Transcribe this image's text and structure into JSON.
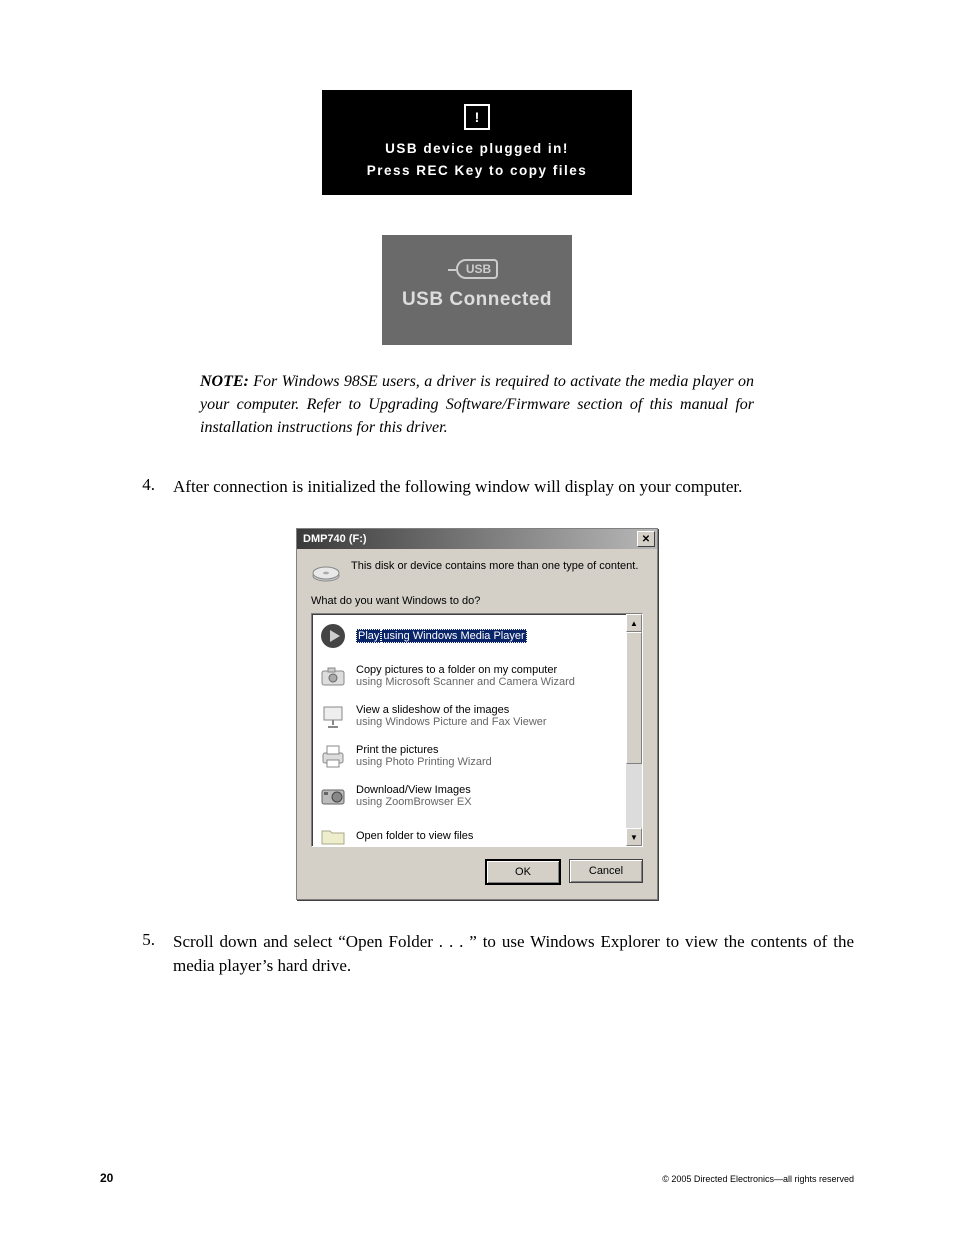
{
  "banner1": {
    "line1": "USB device plugged in!",
    "line2": "Press REC Key to copy files"
  },
  "banner2": {
    "logo": "USB",
    "text": "USB Connected"
  },
  "note": {
    "label": "NOTE:",
    "body": "For Windows 98SE users, a driver is required to activate the media player on your computer. Refer to Upgrading Software/Firmware section of this manual for installation instructions for this driver."
  },
  "steps": {
    "s4": {
      "num": "4.",
      "text": "After connection is initialized the following window will display on your computer."
    },
    "s5": {
      "num": "5.",
      "text": "Scroll down and select “Open Folder . . . ” to use Windows Explorer to view the contents of the media player’s hard drive."
    }
  },
  "dialog": {
    "title": "DMP740 (F:)",
    "close": "✕",
    "msg": "This disk or device contains more than one type of content.",
    "question": "What do you want Windows to do?",
    "options": [
      {
        "t1": "Play",
        "t2": "using Windows Media Player",
        "selected": true,
        "icon": "play"
      },
      {
        "t1": "Copy pictures to a folder on my computer",
        "t2": "using Microsoft Scanner and Camera Wizard",
        "icon": "camera"
      },
      {
        "t1": "View a slideshow of the images",
        "t2": "using Windows Picture and Fax Viewer",
        "icon": "slideshow"
      },
      {
        "t1": "Print the pictures",
        "t2": "using Photo Printing Wizard",
        "icon": "printer"
      },
      {
        "t1": "Download/View Images",
        "t2": "using ZoomBrowser EX",
        "icon": "camera2"
      },
      {
        "t1": "Open folder to view files",
        "t2": "",
        "icon": "folder"
      }
    ],
    "ok": "OK",
    "cancel": "Cancel",
    "scroll_up": "▲",
    "scroll_down": "▼"
  },
  "footer": {
    "page": "20",
    "copyright": "© 2005 Directed Electronics—all rights reserved"
  }
}
